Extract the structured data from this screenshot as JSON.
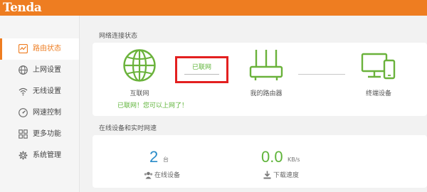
{
  "brand": {
    "logo_text": "Tenda",
    "accent_color": "#ee7d21"
  },
  "sidebar": {
    "items": [
      {
        "label": "路由状态",
        "icon": "router-status-icon",
        "active": true
      },
      {
        "label": "上网设置",
        "icon": "globe-icon",
        "active": false
      },
      {
        "label": "无线设置",
        "icon": "wifi-icon",
        "active": false
      },
      {
        "label": "网速控制",
        "icon": "speedometer-icon",
        "active": false
      },
      {
        "label": "更多功能",
        "icon": "grid-icon",
        "active": false
      },
      {
        "label": "系统管理",
        "icon": "gear-icon",
        "active": false
      }
    ]
  },
  "network_status": {
    "section_title": "网络连接状态",
    "internet_label": "互联网",
    "connection_status": "已联网",
    "status_message": "已联网！您可以上网了！",
    "router_label": "我的路由器",
    "devices_label": "终端设备",
    "status_color": "#5fb43a",
    "highlight_color": "#e32020"
  },
  "realtime": {
    "section_title": "在线设备和实时网速",
    "online_devices": {
      "value": "2",
      "unit": "台",
      "label": "在线设备",
      "icon": "users-icon",
      "color": "#2a8cc9"
    },
    "download_speed": {
      "value": "0.0",
      "unit": "KB/s",
      "label": "下载速度",
      "icon": "download-icon",
      "color": "#5fb43a"
    }
  }
}
